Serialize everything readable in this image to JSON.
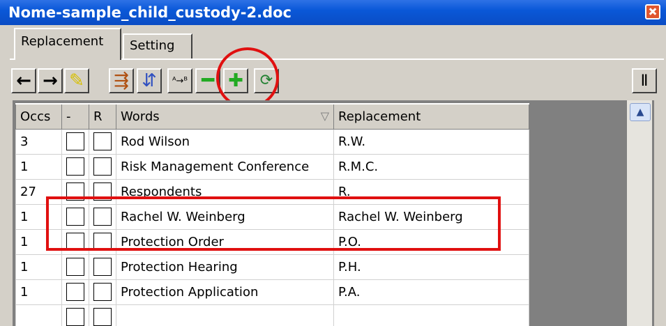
{
  "window": {
    "title": "Nome-sample_child_custody-2.doc"
  },
  "tabs": [
    {
      "label": "Replacement"
    },
    {
      "label": "Setting"
    }
  ],
  "toolbar": {
    "buttons": [
      {
        "icon": "arrow-left-icon",
        "glyph": "←"
      },
      {
        "icon": "arrow-right-icon",
        "glyph": "→"
      },
      {
        "icon": "pencil-highlight-icon",
        "glyph": "✎"
      },
      {
        "icon": "replace-forward-icon",
        "glyph": "⇶"
      },
      {
        "icon": "replace-back-icon",
        "glyph": "⇵"
      },
      {
        "icon": "abbreviate-icon",
        "glyph": "ᴬ→ᴮ"
      },
      {
        "icon": "minus-icon",
        "glyph": "━"
      },
      {
        "icon": "plus-icon",
        "glyph": "✚"
      },
      {
        "icon": "refresh-icon",
        "glyph": "⟳"
      }
    ],
    "pin_glyph": "Ⅱ"
  },
  "grid": {
    "columns": [
      "Occs",
      "-",
      "R",
      "Words",
      "Replacement"
    ],
    "rows": [
      {
        "occs": "3",
        "word": "Rod Wilson",
        "replacement": "R.W."
      },
      {
        "occs": "1",
        "word": "Risk Management Conference",
        "replacement": "R.M.C."
      },
      {
        "occs": "27",
        "word": "Respondents",
        "replacement": "R."
      },
      {
        "occs": "1",
        "word": "Rachel W. Weinberg",
        "replacement": "Rachel W. Weinberg"
      },
      {
        "occs": "1",
        "word": "Protection Order",
        "replacement": "P.O."
      },
      {
        "occs": "1",
        "word": "Protection Hearing",
        "replacement": "P.H."
      },
      {
        "occs": "1",
        "word": "Protection Application",
        "replacement": "P.A."
      },
      {
        "occs": "",
        "word": "",
        "replacement": ""
      }
    ]
  },
  "colors": {
    "title_bar": "#0a58d8",
    "annotation": "#e01010",
    "minus": "#22aa22",
    "plus": "#22aa22"
  }
}
